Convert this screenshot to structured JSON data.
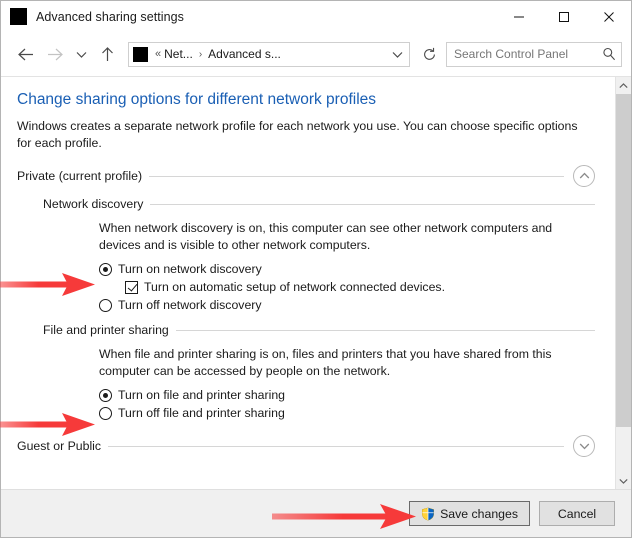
{
  "window": {
    "title": "Advanced sharing settings",
    "icon": "app-icon-redacted",
    "controls": {
      "minimize": "minimize-icon",
      "maximize": "maximize-icon",
      "close": "close-icon"
    }
  },
  "navbar": {
    "back": "back-arrow-icon",
    "forward": "forward-arrow-icon",
    "recent": "chevron-down-icon",
    "up": "up-arrow-icon",
    "address": {
      "icon": "control-panel-icon-redacted",
      "chevron": "«",
      "segments": [
        "Net...",
        "Advanced s..."
      ],
      "separator": "›",
      "dropdown": "chevron-down-icon"
    },
    "refresh": "refresh-icon",
    "search": {
      "placeholder": "Search Control Panel",
      "value": "",
      "icon": "search-icon"
    }
  },
  "main": {
    "page_title": "Change sharing options for different network profiles",
    "intro": "Windows creates a separate network profile for each network you use. You can choose specific options for each profile.",
    "profiles": [
      {
        "name": "Private (current profile)",
        "expanded": true,
        "toggle_icon": "chevron-up-icon",
        "sections": [
          {
            "name": "Network discovery",
            "description": "When network discovery is on, this computer can see other network computers and devices and is visible to other network computers.",
            "options": [
              {
                "type": "radio",
                "label": "Turn on network discovery",
                "checked": true,
                "indent": false
              },
              {
                "type": "checkbox",
                "label": "Turn on automatic setup of network connected devices.",
                "checked": true,
                "indent": true
              },
              {
                "type": "radio",
                "label": "Turn off network discovery",
                "checked": false,
                "indent": false
              }
            ]
          },
          {
            "name": "File and printer sharing",
            "description": "When file and printer sharing is on, files and printers that you have shared from this computer can be accessed by people on the network.",
            "options": [
              {
                "type": "radio",
                "label": "Turn on file and printer sharing",
                "checked": true,
                "indent": false
              },
              {
                "type": "radio",
                "label": "Turn off file and printer sharing",
                "checked": false,
                "indent": false
              }
            ]
          }
        ]
      },
      {
        "name": "Guest or Public",
        "expanded": false,
        "toggle_icon": "chevron-down-icon",
        "sections": []
      }
    ]
  },
  "scrollbar": {
    "up": "scroll-up-icon",
    "down": "scroll-down-icon",
    "thumb_position_percent": 0
  },
  "footer": {
    "save_label": "Save changes",
    "save_icon": "uac-shield-icon",
    "cancel_label": "Cancel"
  },
  "annotations": {
    "arrow_color": "#f63a3a",
    "arrows": [
      {
        "name": "arrow-network-discovery-on",
        "points_to": "Turn on network discovery"
      },
      {
        "name": "arrow-file-printer-sharing-on",
        "points_to": "Turn on file and printer sharing"
      },
      {
        "name": "arrow-save-changes",
        "points_to": "Save changes"
      }
    ]
  },
  "colors": {
    "title_link": "#1a5fb4",
    "arrow": "#f63a3a",
    "shield_yellow": "#ffd23a",
    "shield_blue": "#0a65c4",
    "footer_bg": "#f0f0f0"
  }
}
